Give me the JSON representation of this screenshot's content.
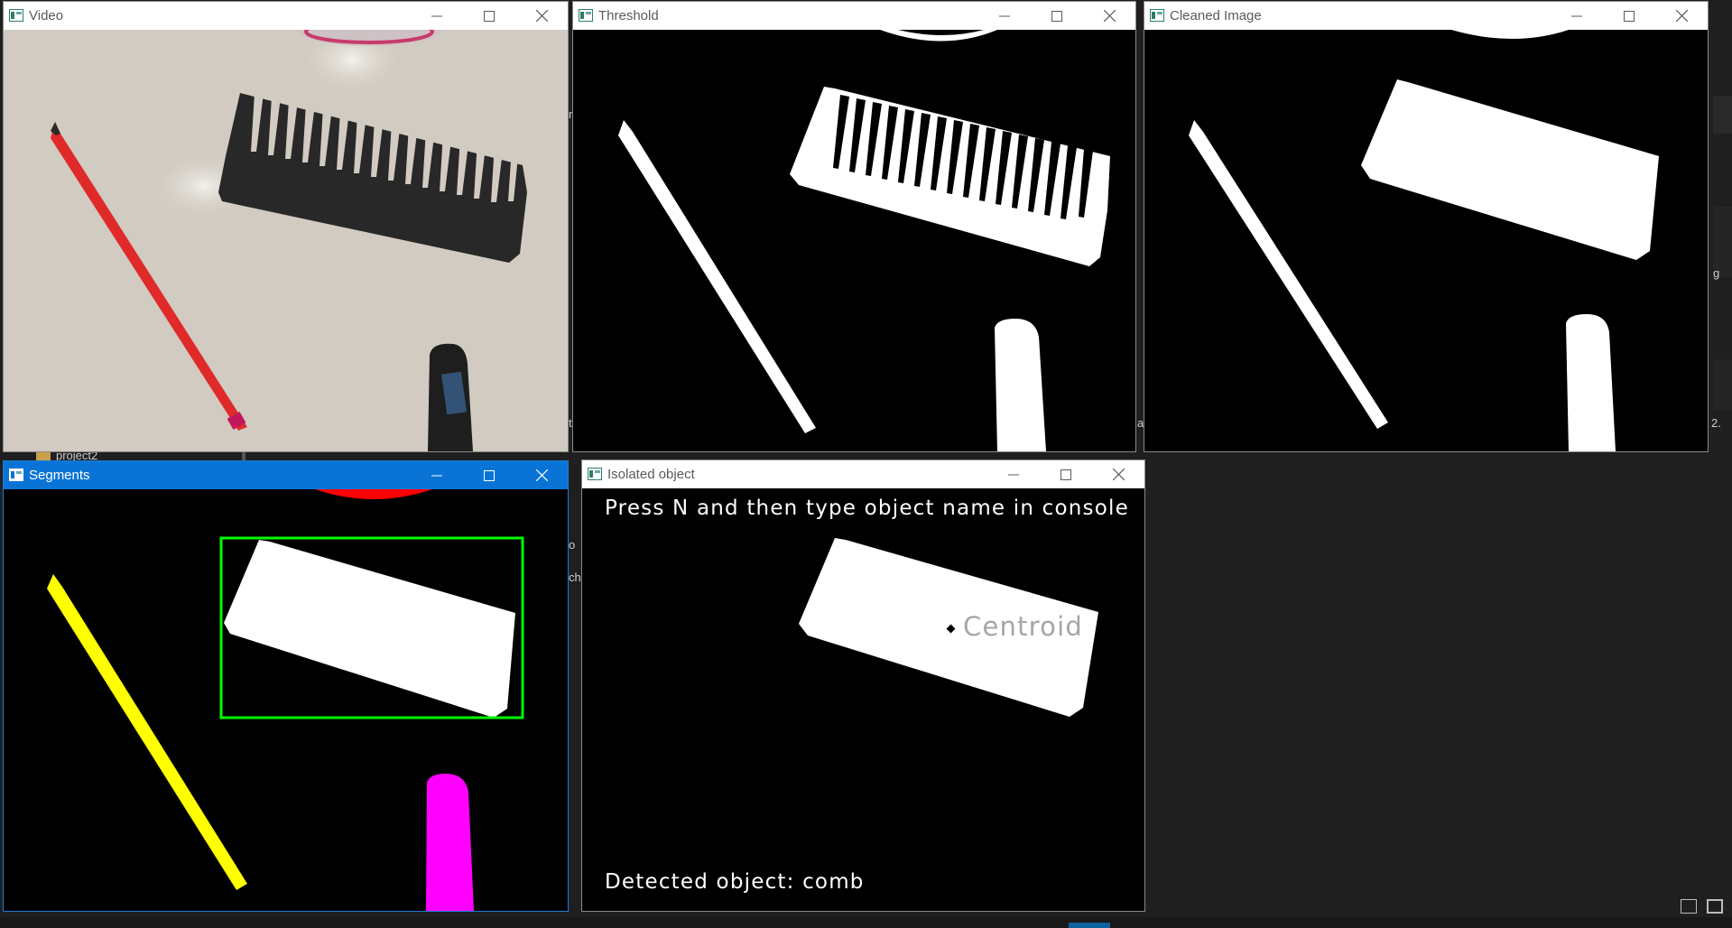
{
  "windows": {
    "video": {
      "title": "Video"
    },
    "threshold": {
      "title": "Threshold"
    },
    "cleaned": {
      "title": "Cleaned Image"
    },
    "segments": {
      "title": "Segments"
    },
    "isolated": {
      "title": "Isolated object",
      "instruction": "Press N and then type object name in console",
      "centroid_label": "Centroid",
      "detected_label": "Detected object: comb"
    }
  },
  "background": {
    "folder_label": "project2",
    "glyphs": [
      "r",
      "g",
      "a",
      "2.",
      "o",
      "ch",
      "t"
    ]
  },
  "colors": {
    "titlebar_active": "#0a74d6",
    "segment_pencil": "#ffff00",
    "segment_cap": "#ff00ff",
    "segment_top": "#ff0000",
    "bounding_box": "#00ff00"
  },
  "icons": [
    "window-app-icon",
    "minimize-icon",
    "maximize-icon",
    "close-icon",
    "folder-icon",
    "layout-list-icon",
    "layout-panel-icon"
  ]
}
